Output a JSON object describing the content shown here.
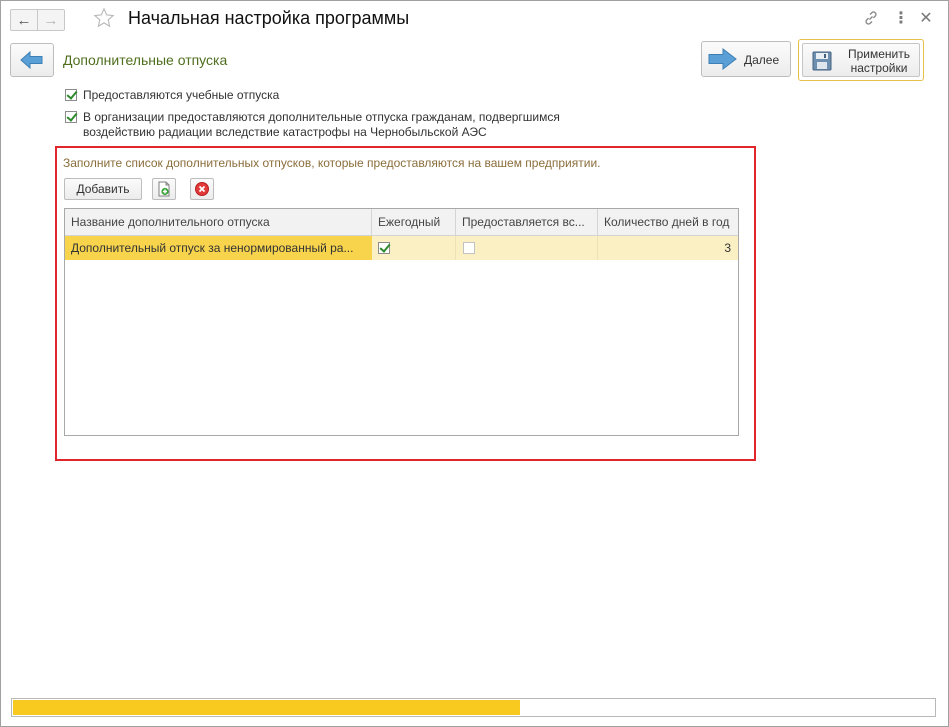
{
  "window": {
    "title": "Начальная настройка программы"
  },
  "header": {
    "section_title": "Дополнительные отпуска",
    "next_label": "Далее",
    "apply_label_line1": "Применить",
    "apply_label_line2": "настройки"
  },
  "options": [
    {
      "label": "Предоставляются учебные отпуска",
      "checked": true
    },
    {
      "label_line1": "В организации предоставляются дополнительные отпуска гражданам, подвергшимся",
      "label_line2": "воздействию радиации вследствие катастрофы на Чернобыльской АЭС",
      "checked": true
    }
  ],
  "list": {
    "hint": "Заполните список дополнительных отпусков, которые предоставляются на вашем предприятии.",
    "add_label": "Добавить",
    "columns": [
      "Название дополнительного отпуска",
      "Ежегодный",
      "Предоставляется вс...",
      "Количество дней в год"
    ],
    "rows": [
      {
        "name": "Дополнительный отпуск за ненормированный ра...",
        "annual": true,
        "provided_all": false,
        "days": "3"
      }
    ]
  },
  "progress": {
    "fraction": 0.55
  },
  "colors": {
    "accent": "#f8c91f",
    "section_title": "#4f6e1e",
    "frame": "#e0262b",
    "selected_row": "#fbf0c4",
    "selected_cell": "#f7d44c"
  }
}
